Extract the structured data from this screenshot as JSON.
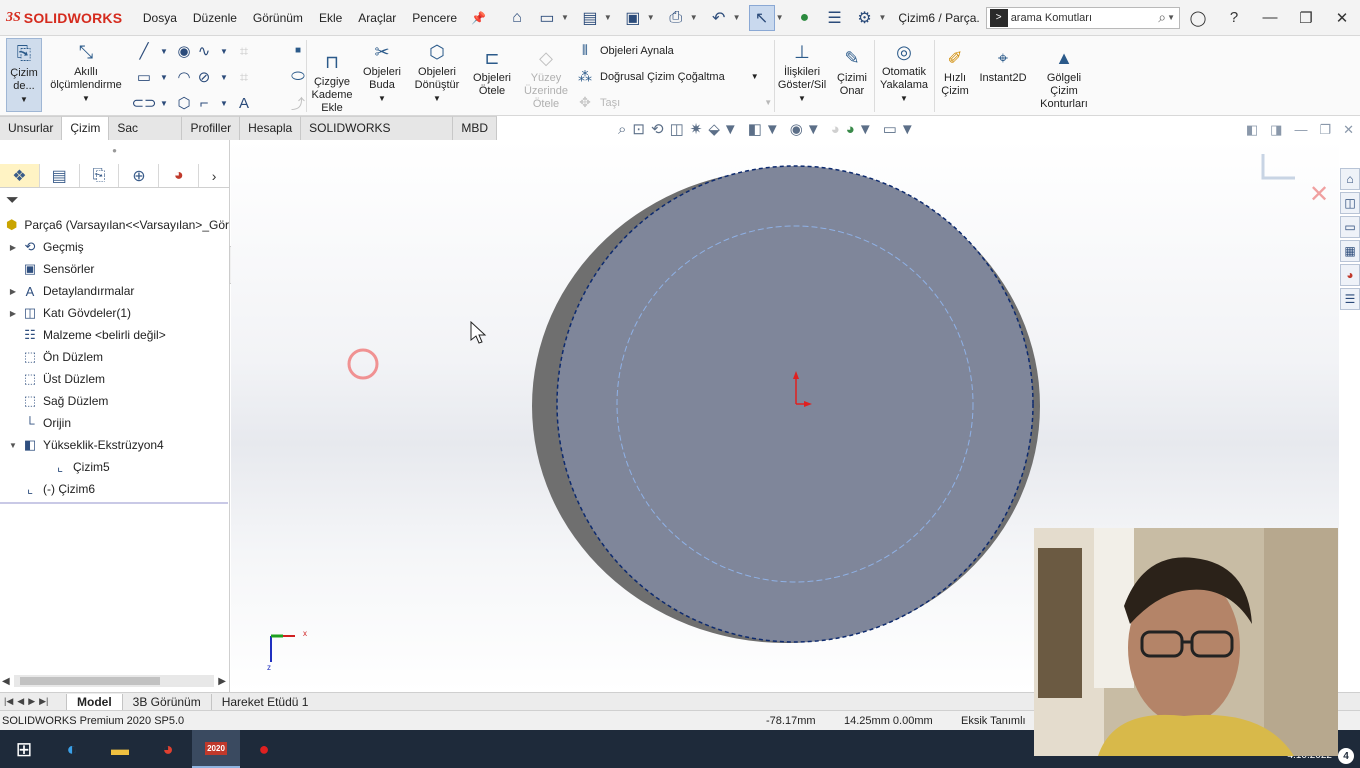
{
  "app": {
    "brand_prefix": "3S",
    "brand_name": "SOLIDWORKS",
    "document_title": "Çizim6 / Parça...",
    "search_placeholder": "arama Komutları"
  },
  "menu": [
    "Dosya",
    "Düzenle",
    "Görünüm",
    "Ekle",
    "Araçlar",
    "Pencere"
  ],
  "commands": {
    "sketch_exit": "Çizim de...",
    "smart_dim_1": "Akıllı",
    "smart_dim_2": "ölçümlendirme",
    "offset_1": "Çizgiye",
    "offset_2": "Kademe",
    "offset_3": "Ekle",
    "trim_1": "Objeleri",
    "trim_2": "Buda",
    "convert_1": "Objeleri",
    "convert_2": "Dönüştür",
    "offset_ent_1": "Objeleri",
    "offset_ent_2": "Ötele",
    "surface_offset_1": "Yüzey",
    "surface_offset_2": "Üzerinde",
    "surface_offset_3": "Ötele",
    "mirror": "Objeleri Aynala",
    "linear_pattern": "Doğrusal Çizim Çoğaltma",
    "move": "Taşı",
    "relations_1": "İlişkileri",
    "relations_2": "Göster/Sil",
    "repair_1": "Çizimi",
    "repair_2": "Onar",
    "snap_1": "Otomatik",
    "snap_2": "Yakalama",
    "rapid_1": "Hızlı",
    "rapid_2": "Çizim",
    "instant2d": "Instant2D",
    "shaded_1": "Gölgeli",
    "shaded_2": "Çizim",
    "shaded_3": "Konturları"
  },
  "tabs": [
    "Unsurlar",
    "Çizim",
    "Sac Levha",
    "Profiller",
    "Hesapla",
    "SOLIDWORKS Eklentileri",
    "MBD"
  ],
  "active_tab": "Çizim",
  "tree": {
    "root": "Parça6  (Varsayılan<<Varsayılan>_Gör",
    "items": [
      {
        "label": "Geçmiş",
        "icon": "history-icon",
        "expandable": true
      },
      {
        "label": "Sensörler",
        "icon": "sensor-icon",
        "expandable": false
      },
      {
        "label": "Detaylandırmalar",
        "icon": "annotation-icon",
        "expandable": true
      },
      {
        "label": "Katı Gövdeler(1)",
        "icon": "solid-body-icon",
        "expandable": true
      },
      {
        "label": "Malzeme <belirli değil>",
        "icon": "material-icon",
        "expandable": false
      },
      {
        "label": "Ön Düzlem",
        "icon": "plane-icon",
        "expandable": false
      },
      {
        "label": "Üst Düzlem",
        "icon": "plane-icon",
        "expandable": false
      },
      {
        "label": "Sağ Düzlem",
        "icon": "plane-icon",
        "expandable": false
      },
      {
        "label": "Orijin",
        "icon": "origin-icon",
        "expandable": false
      },
      {
        "label": "Yükseklik-Ekstrüzyon4",
        "icon": "extrude-icon",
        "expandable": true,
        "expanded": true
      },
      {
        "label": "Çizim5",
        "icon": "sketch-icon",
        "expandable": false,
        "child": true
      },
      {
        "label": "(-) Çizim6",
        "icon": "sketch-icon",
        "expandable": false
      }
    ]
  },
  "model_tabs": [
    "Model",
    "3B Görünüm",
    "Hareket Etüdü 1"
  ],
  "status": {
    "product": "SOLIDWORKS Premium 2020 SP5.0",
    "x": "-78.17mm",
    "y": "14.25mm",
    "z": "0.00mm",
    "definition": "Eksik Tanımlı"
  },
  "taskbar": {
    "date": "4.10.2022",
    "notifications": "4",
    "sw_badge": "2020"
  },
  "axes": {
    "x": "x",
    "y": "y",
    "z": "z"
  },
  "colors": {
    "accent": "#d52b1e",
    "disk": "#7f869a",
    "disk_shadow": "#6c6c6c",
    "sketch_circle": "#8fb1e6",
    "selection": "#c9d9ee"
  }
}
